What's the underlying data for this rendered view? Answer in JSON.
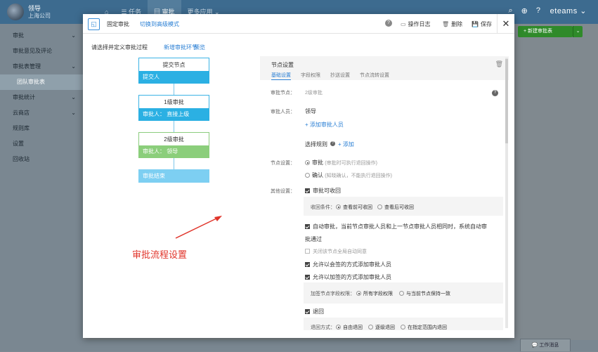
{
  "topbar": {
    "user": "领导",
    "company": "上海公司",
    "nav": [
      {
        "label": "⌂",
        "id": "home"
      },
      {
        "label": "☰ 任务",
        "id": "tasks"
      },
      {
        "label": "▤ 审批",
        "id": "approval"
      },
      {
        "label": "更多应用 ⌄",
        "id": "more-apps"
      }
    ],
    "brand": "eteams ⌄"
  },
  "sidebar": {
    "items": [
      {
        "label": "审批",
        "chev": "⌄"
      },
      {
        "label": "审批意见及评论",
        "chev": ""
      },
      {
        "label": "审批表管理",
        "chev": "⌄"
      },
      {
        "label": "团队审批表",
        "chev": ""
      },
      {
        "label": "审批统计",
        "chev": "⌄"
      },
      {
        "label": "云商店",
        "chev": "⌄"
      },
      {
        "label": "规则库",
        "chev": ""
      },
      {
        "label": "设置",
        "chev": ""
      },
      {
        "label": "回收站",
        "chev": ""
      }
    ]
  },
  "main": {
    "new_button": "+ 新建审批表",
    "new_arrow": "⌄"
  },
  "footer": {
    "work_msg": "💬 工作消息"
  },
  "modal": {
    "mode_icon": "◱",
    "mode_fixed": "固定审批",
    "mode_switch": "切换到高级模式",
    "help": "?",
    "actions": {
      "log": "操作日志",
      "delete": "删除",
      "save": "保存"
    },
    "close": "✕",
    "hint": "请选择并定义审批过程",
    "add_step": "新增审批环节",
    "preview": "预览",
    "flow": {
      "submit": {
        "title": "提交节点",
        "body": "提交人"
      },
      "level1": {
        "title": "1级审批",
        "body": "审批人：  直接上级"
      },
      "level2": {
        "title": "2级审批",
        "body": "审批人：  领导"
      },
      "end": "审批结束"
    },
    "annotation": "审批流程设置",
    "panel": {
      "title": "节点设置",
      "trash": "🗑",
      "tabs": [
        "基础设置",
        "字段权限",
        "抄送设置",
        "节点流转设置"
      ],
      "node_label": "审批节点：",
      "node_value": "2级审批",
      "approver_label": "审批人员：",
      "approver_value": "领导",
      "add_approver": "+ 添加审批人员",
      "select_rule": "选择规则",
      "add_rule": "+ 添加",
      "node_setting_label": "节点设置：",
      "opt_approve": "审批",
      "opt_approve_note": "(审批时可执行退回操作)",
      "opt_confirm": "确认",
      "opt_confirm_note": "(知晓确认，不能执行退回操作)",
      "other_label": "其他设置：",
      "recallable": "审批可收回",
      "recall_cond_label": "收回条件：",
      "recall_opt1": "查看前可收回",
      "recall_opt2": "查看后可收回",
      "auto_approve": "自动审批，当前节点审批人员和上一节点审批人员相同时，系统自动审",
      "auto_approve_cont": "批通过",
      "disable_global": "关闭该节点全局自动同意",
      "allow_cosign": "允许以会签的方式添加审批人员",
      "allow_addsign": "允许以加签的方式添加审批人员",
      "addsign_perm_label": "加签节点字段权限：",
      "perm_opt1": "所有字段权限",
      "perm_opt2": "与当前节点保持一致",
      "return": "退回",
      "return_method_label": "退回方式：",
      "ret_opt1": "自由退回",
      "ret_opt2": "逐级退回",
      "ret_opt3": "在指定范围内退回"
    }
  }
}
